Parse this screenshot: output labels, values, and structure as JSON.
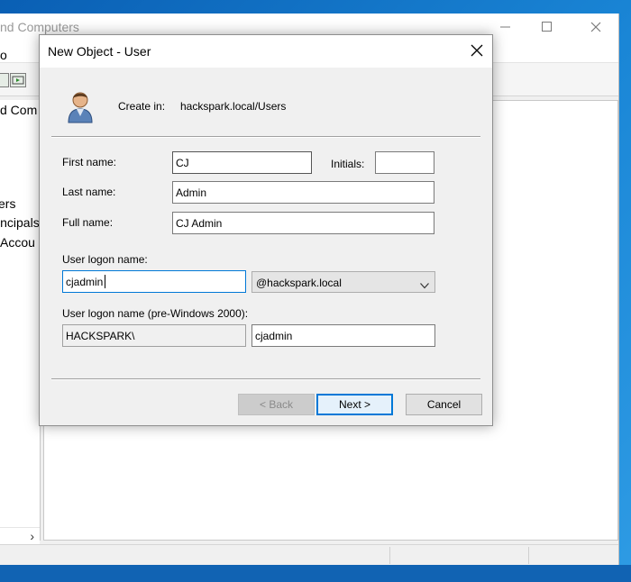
{
  "background_window": {
    "title": "nd Computers",
    "menu_fragment": "o",
    "tree_items": [
      "d Com",
      "ers",
      "incipals",
      "Accou"
    ],
    "scroll_arrow": "›"
  },
  "dialog": {
    "title": "New Object - User",
    "create_in_label": "Create in:",
    "create_in_path": "hackspark.local/Users",
    "fields": {
      "first_name": {
        "label": "First name:",
        "value": "CJ"
      },
      "initials": {
        "label": "Initials:",
        "value": ""
      },
      "last_name": {
        "label": "Last name:",
        "value": "Admin"
      },
      "full_name": {
        "label": "Full name:",
        "value": "CJ Admin"
      },
      "logon_name": {
        "label": "User logon name:",
        "value": "cjadmin"
      },
      "upn_suffix": {
        "selected": "@hackspark.local"
      },
      "pre2000": {
        "label": "User logon name (pre-Windows 2000):",
        "domain": "HACKSPARK\\",
        "value": "cjadmin"
      }
    },
    "buttons": {
      "back": "< Back",
      "next": "Next >",
      "cancel": "Cancel"
    }
  },
  "colors": {
    "accent": "#0078d7",
    "desktop": "#1a86d6",
    "dialog_bg": "#f0f0f0"
  }
}
